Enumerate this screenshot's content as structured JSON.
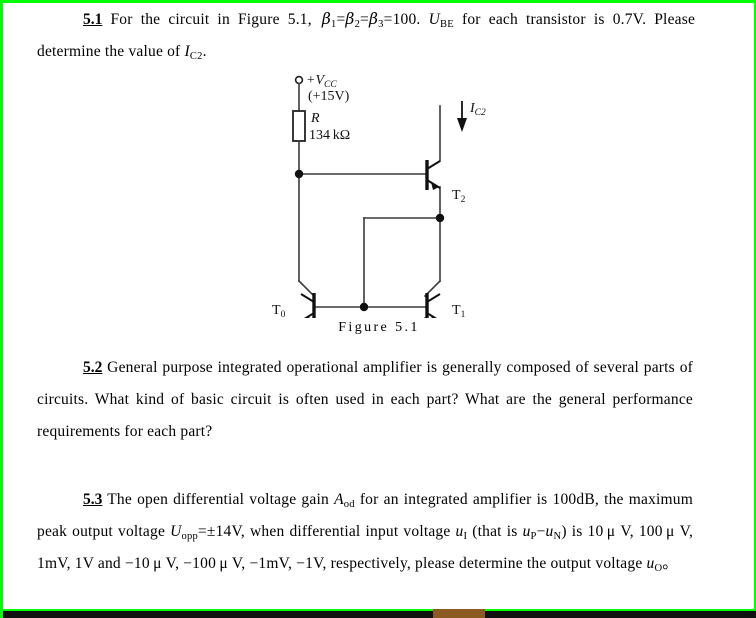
{
  "document": {
    "border_color": "#00ff00",
    "background": "#ffffff",
    "text_color": "#000000"
  },
  "problems": [
    {
      "id": "5.1",
      "number": "5.1",
      "line1_a": "For the circuit in Figure 5.1,",
      "beta1": "β",
      "beta1_sub": "1",
      "eq1": "=",
      "beta2": "β",
      "beta2_sub": "2",
      "eq2": "=",
      "beta3": "β",
      "beta3_sub": "3",
      "eq3": "=100.",
      "ube": "U",
      "ube_sub": "BE",
      "line1_b": "for each transistor",
      "line2_a": "is 0.7V. Please determine the value of",
      "ic2": "I",
      "ic2_sub": "C2",
      "line2_b": "."
    },
    {
      "id": "5.2",
      "number": "5.2",
      "body": "General purpose integrated operational amplifier is generally composed of several parts of circuits. What kind of basic circuit is often used in each part? What are the general performance requirements for each part?"
    },
    {
      "id": "5.3",
      "number": "5.3",
      "seg1": "The open differential voltage gain",
      "aod": "A",
      "aod_sub": "od",
      "seg2": "for an integrated amplifier is 100dB, the maximum peak output voltage",
      "uopp": "U",
      "uopp_sub": "opp",
      "seg3": "=",
      "pm14": "±14V, when differential input voltage",
      "ui": "u",
      "ui_sub": "I",
      "seg4": "(that is",
      "up": "u",
      "up_sub": "P",
      "minus": "−",
      "un": "u",
      "un_sub": "N",
      "seg5": ") is 10 μ V, 100 μ V, 1mV, 1V and",
      "seg6": "−10 μ V,",
      "seg7": "−100 μ V,",
      "seg8": "−1mV,",
      "seg9": "−1V, respectively, please determine the output voltage",
      "uo": "u",
      "uo_sub": "O",
      "period": "。"
    }
  ],
  "figure": {
    "caption": "Figure 5.1",
    "supply_label": "+V",
    "supply_sub": "CC",
    "supply_value": "(+15V)",
    "resistor_name": "R",
    "resistor_value": "134 kΩ",
    "current_label": "I",
    "current_sub": "C2",
    "transistors": [
      {
        "name": "T",
        "sub": "0"
      },
      {
        "name": "T",
        "sub": "1"
      },
      {
        "name": "T",
        "sub": "2"
      }
    ],
    "line_color": "#3a3a3a",
    "symbol_color": "#111111"
  }
}
